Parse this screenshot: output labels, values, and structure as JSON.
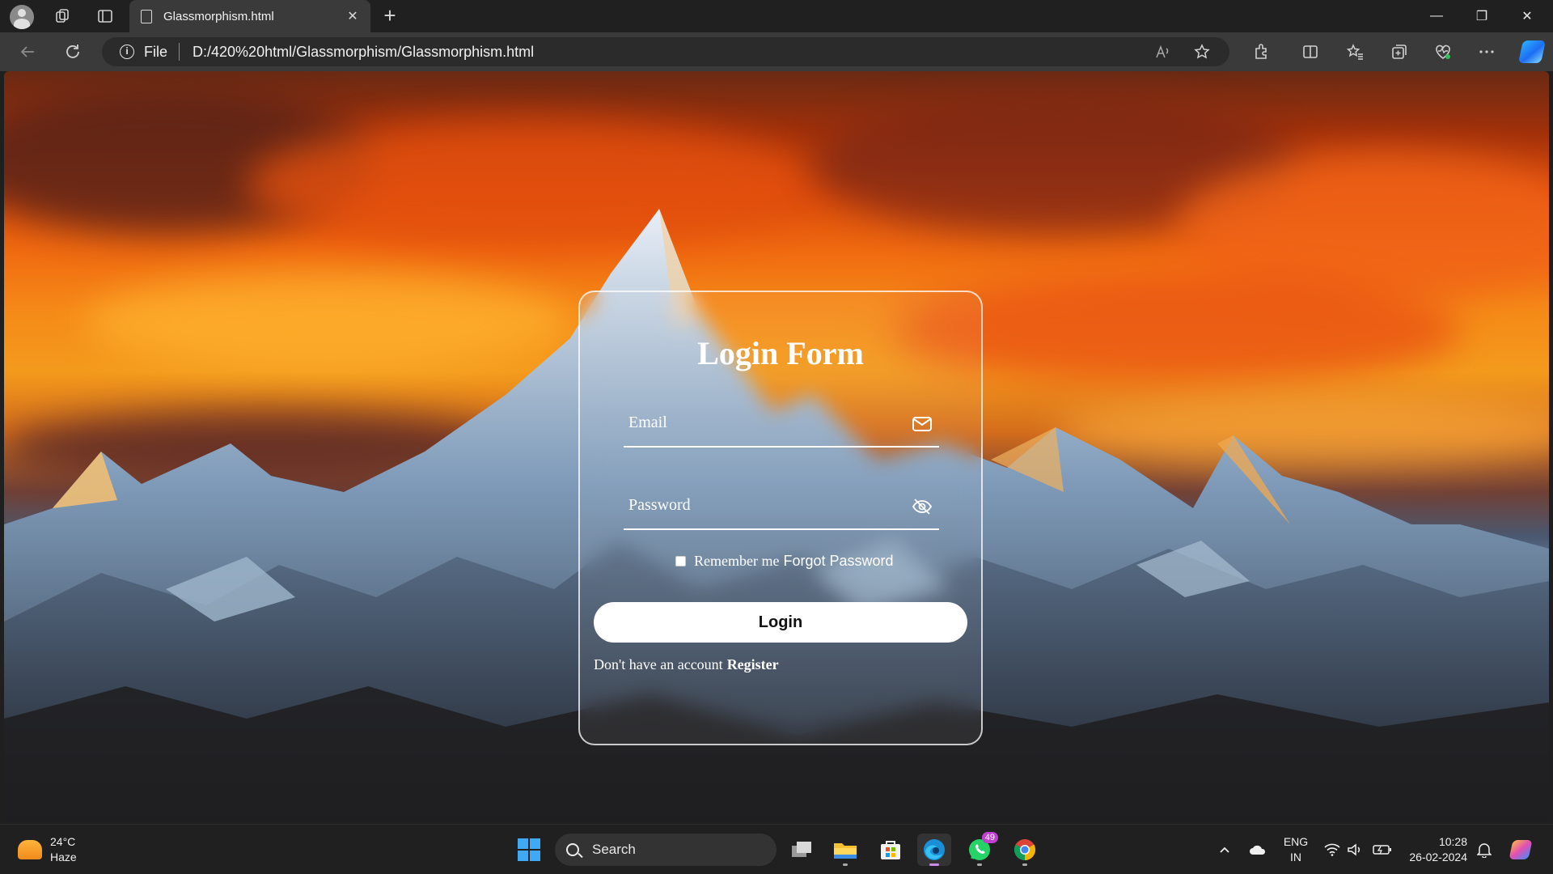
{
  "browser": {
    "tab_title": "Glassmorphism.html",
    "tab_close": "✕",
    "new_tab": "+",
    "address_scheme": "File",
    "address_url": "D:/420%20html/Glassmorphism/Glassmorphism.html"
  },
  "window_controls": {
    "minimize": "—",
    "restore": "❐",
    "close": "✕"
  },
  "login": {
    "title": "Login Form",
    "email_placeholder": "Email",
    "password_placeholder": "Password",
    "remember_label": "Remember me",
    "forgot_label": "Forgot Password",
    "login_button": "Login",
    "no_account_text": "Don't have an account",
    "register_link": "Register"
  },
  "taskbar": {
    "weather_temp": "24°C",
    "weather_desc": "Haze",
    "search_label": "Search",
    "whatsapp_badge": "49",
    "lang_primary": "ENG",
    "lang_secondary": "IN",
    "time": "10:28",
    "date": "26-02-2024"
  },
  "colors": {
    "accent_blue": "#3fa9f5",
    "badge_purple": "#c03ed0",
    "card_border": "#ffffff"
  },
  "icons": [
    "profile-icon",
    "workspaces-icon",
    "tab-actions-icon",
    "document-icon",
    "back-icon",
    "refresh-icon",
    "info-icon",
    "read-aloud-icon",
    "favorite-star-icon",
    "extensions-icon",
    "split-screen-icon",
    "favorites-icon",
    "collections-icon",
    "browser-essentials-icon",
    "more-icon",
    "copilot-icon",
    "mail-icon",
    "eye-off-icon",
    "windows-start-icon",
    "search-icon",
    "task-view-icon",
    "file-explorer-icon",
    "store-icon",
    "edge-icon",
    "whatsapp-icon",
    "chrome-icon",
    "chevron-up-icon",
    "onedrive-icon",
    "wifi-icon",
    "volume-icon",
    "battery-icon",
    "bell-icon"
  ]
}
